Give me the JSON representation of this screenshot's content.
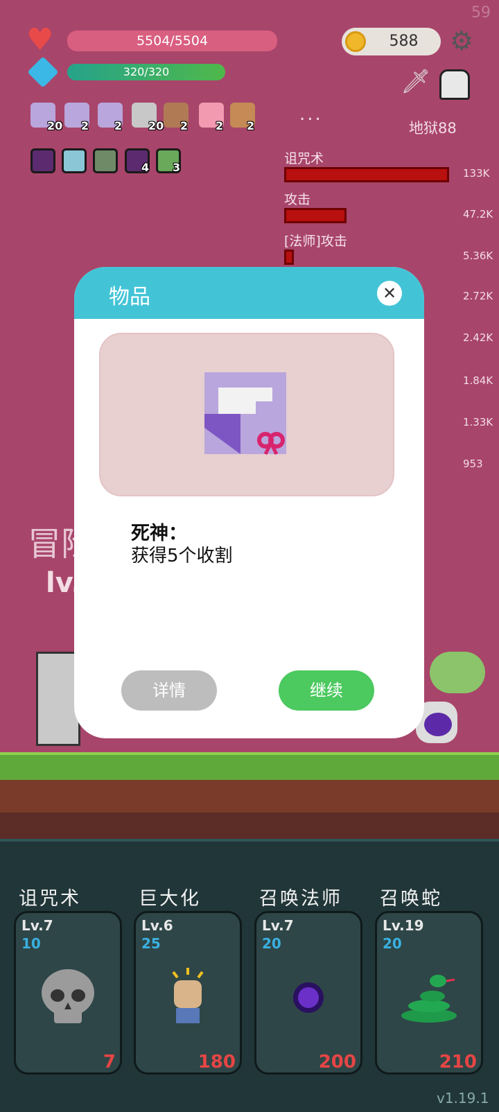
{
  "hud": {
    "fps": "59",
    "hp": "5504/5504",
    "hp_fraction": 1.0,
    "mp": "320/320",
    "mp_fraction": 1.0,
    "gold": "588",
    "hell_level": "地狱88",
    "more": "..."
  },
  "inventory": {
    "row1": [
      {
        "icon": "gift-scroll-icon",
        "count": "20"
      },
      {
        "icon": "gift-scroll-icon",
        "count": "2"
      },
      {
        "icon": "gift-scroll-icon",
        "count": "2"
      },
      {
        "icon": "hook-icon",
        "count": "20"
      },
      {
        "icon": "target-icon",
        "count": "2"
      },
      {
        "icon": "potion-icon",
        "count": "2"
      },
      {
        "icon": "drumstick-icon",
        "count": "2"
      }
    ],
    "row2": [
      {
        "icon": "demon-card-icon",
        "count": ""
      },
      {
        "icon": "light-card-icon",
        "count": ""
      },
      {
        "icon": "robot-card-icon",
        "count": ""
      },
      {
        "icon": "demon-card-icon",
        "count": "4"
      },
      {
        "icon": "check-card-icon",
        "count": "3"
      }
    ]
  },
  "damage_stats": [
    {
      "label": "诅咒术",
      "value": "133K",
      "fraction": 1.0
    },
    {
      "label": "攻击",
      "value": "47.2K",
      "fraction": 0.38
    },
    {
      "label": "[法师]攻击",
      "value": "5.36K",
      "fraction": 0.06
    }
  ],
  "extra_values": [
    "2.72K",
    "2.42K",
    "1.84K",
    "1.33K",
    "953"
  ],
  "scene": {
    "adventure_text": "冒险",
    "level_text": "lv."
  },
  "modal": {
    "title": "物品",
    "item_name": "死神：",
    "item_desc": "获得5个收割",
    "details_label": "详情",
    "continue_label": "继续"
  },
  "skills": [
    {
      "name": "诅咒术",
      "level": "Lv.7",
      "cost": "10",
      "damage": "7",
      "icon": "skull-icon"
    },
    {
      "name": "巨大化",
      "level": "Lv.6",
      "cost": "25",
      "damage": "180",
      "icon": "fist-icon"
    },
    {
      "name": "召唤法师",
      "level": "Lv.7",
      "cost": "20",
      "damage": "200",
      "icon": "purple-orb-icon"
    },
    {
      "name": "召唤蛇",
      "level": "Lv.19",
      "cost": "20",
      "damage": "210",
      "icon": "snake-icon"
    }
  ],
  "version": "v1.19.1",
  "colors": {
    "background": "#a8456a",
    "modal_header": "#43c4d6",
    "continue_button": "#4cc95f",
    "details_button": "#bdbdbd",
    "damage_bar": "#b80f0f"
  }
}
